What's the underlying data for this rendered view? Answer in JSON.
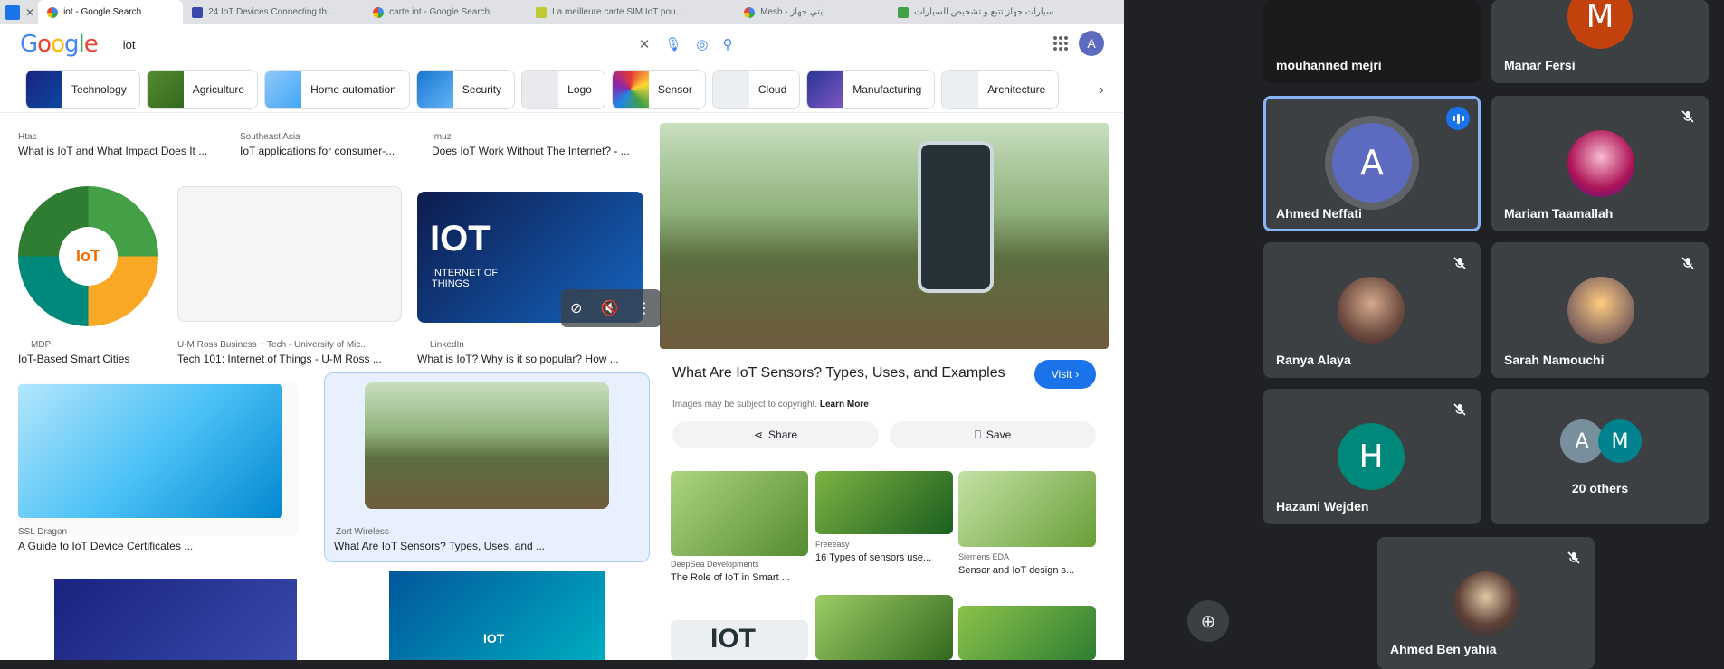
{
  "browser": {
    "tabs": [
      {
        "label": "iot - Google Search",
        "active": true
      },
      {
        "label": "24 IoT Devices Connecting th...",
        "active": false
      },
      {
        "label": "carte iot - Google Search",
        "active": false
      },
      {
        "label": "La meilleure carte SIM IoT pou...",
        "active": false
      },
      {
        "label": "Mesh - ايتي جهاز",
        "active": false
      },
      {
        "label": "سيارات جهاز تتبع و تشخيص السيارات",
        "active": false
      }
    ]
  },
  "search": {
    "logo": {
      "l1": "G",
      "l2": "o",
      "l3": "o",
      "l4": "g",
      "l5": "l",
      "l6": "e"
    },
    "query": "iot",
    "account_initial": "A",
    "chips": [
      "Technology",
      "Agriculture",
      "Home automation",
      "Security",
      "Logo",
      "Sensor",
      "Cloud",
      "Manufacturing",
      "Architecture"
    ]
  },
  "results": [
    {
      "source": "Htas",
      "caption": "What is IoT and What Impact Does It ..."
    },
    {
      "source": "Southeast Asia",
      "caption": "IoT applications for consumer-..."
    },
    {
      "source": "Imuz",
      "caption": "Does IoT Work Without The Internet? - ..."
    },
    {
      "source": "MDPI",
      "caption": "IoT-Based Smart Cities"
    },
    {
      "source": "U-M Ross Business + Tech - University of Mic...",
      "caption": "Tech 101: Internet of Things - U-M Ross ..."
    },
    {
      "source": "LinkedIn",
      "caption": "What is IoT? Why is it so popular? How ..."
    },
    {
      "source": "SSL Dragon",
      "caption": "A Guide to IoT Device Certificates ..."
    },
    {
      "source": "Zort Wireless",
      "caption": "What Are IoT Sensors? Types, Uses, and ..."
    }
  ],
  "image_text": {
    "iot_banner": "IOT",
    "iot_banner_sub": "INTERNET OF THINGS",
    "iot_small": "IOT",
    "iot_bottom": "IOT",
    "iot_ring": "IoT"
  },
  "detail": {
    "title": "What Are IoT Sensors? Types, Uses, and Examples",
    "visit_label": "Visit",
    "copyright": "Images may be subject to copyright.",
    "learn_more": "Learn More",
    "share_label": "Share",
    "save_label": "Save",
    "related": [
      {
        "source": "DeepSea Developments",
        "caption": "The Role of IoT in Smart ..."
      },
      {
        "source": "Freeeasy",
        "caption": "16 Types of sensors use..."
      },
      {
        "source": "Siemens EDA",
        "caption": "Sensor and IoT design s..."
      }
    ]
  },
  "meet": {
    "participants": [
      {
        "name": "mouhanned mejri",
        "initial": ""
      },
      {
        "name": "Manar Fersi",
        "initial": "M"
      },
      {
        "name": "Ahmed Neffati",
        "initial": "A"
      },
      {
        "name": "Mariam Taamallah",
        "initial": ""
      },
      {
        "name": "Ranya Alaya",
        "initial": ""
      },
      {
        "name": "Sarah Namouchi",
        "initial": ""
      },
      {
        "name": "Hazami Wejden",
        "initial": "H"
      },
      {
        "name": "20 others",
        "initial_1": "A",
        "initial_2": "M"
      },
      {
        "name": "Ahmed Ben yahia",
        "initial": ""
      }
    ],
    "colors": {
      "manar": "#c2410c",
      "ahmed": "#5c6bc0",
      "hazami": "#00897b",
      "others_a": "#78909c",
      "others_m": "#00838f",
      "accent": "#8ab4f8"
    }
  }
}
